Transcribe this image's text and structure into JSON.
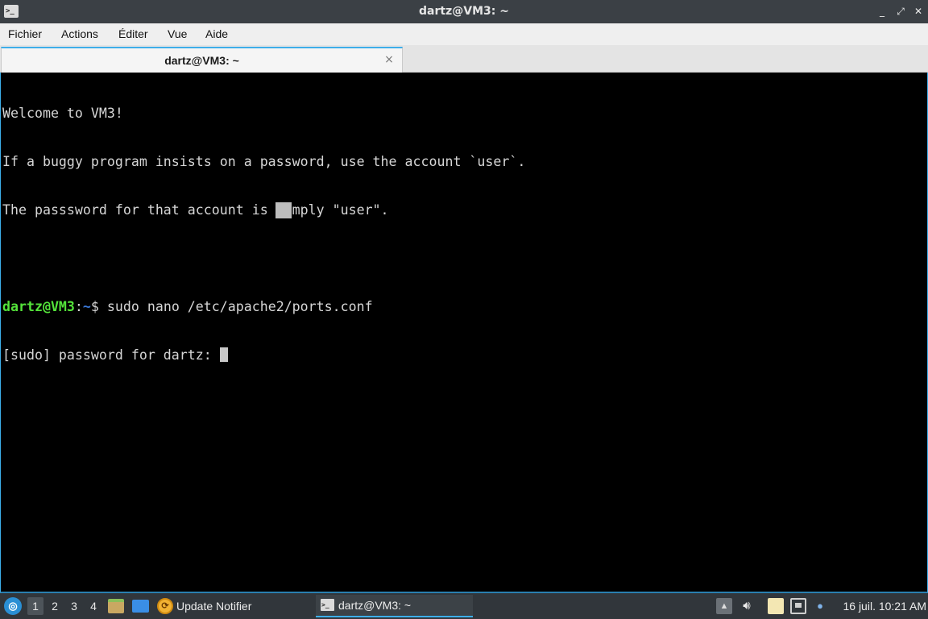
{
  "window": {
    "title": "dartz@VM3: ~",
    "icon": "terminal-icon",
    "minimize_glyph": "_",
    "maximize_glyph": "⤢",
    "close_glyph": "✕"
  },
  "menu": {
    "items": [
      "Fichier",
      "Actions",
      "Éditer",
      "Vue",
      "Aide"
    ]
  },
  "tab": {
    "label": "dartz@VM3: ~",
    "close_glyph": "×"
  },
  "terminal": {
    "motd": [
      "Welcome to VM3!",
      "If a buggy program insists on a password, use the account `user`.",
      "The passsword for that account is simply \"user\"."
    ],
    "prompt_user_host": "dartz@VM3",
    "prompt_sep": ":",
    "prompt_path": "~",
    "prompt_symbol": "$ ",
    "command": "sudo nano /etc/apache2/ports.conf",
    "sudo_prompt": "[sudo] password for dartz: ",
    "colors": {
      "background": "#000000",
      "text": "#d6d6d6",
      "user_host": "#54e33a",
      "path": "#3a78d8"
    }
  },
  "taskbar": {
    "menu_icon": "lubuntu-logo-icon",
    "workspaces": [
      "1",
      "2",
      "3",
      "4"
    ],
    "active_workspace": "1",
    "launchers": [
      "file-manager-icon",
      "show-desktop-icon"
    ],
    "update_notifier": {
      "label": "Update Notifier",
      "icon": "update-notifier-icon"
    },
    "task": {
      "label": "dartz@VM3: ~",
      "icon": "terminal-icon"
    },
    "tray_icons": [
      "tray-arrow-icon",
      "volume-icon",
      "clipboard-icon",
      "network-icon",
      "notification-icon"
    ],
    "clock": "16 juil. 10:21 AM",
    "accent": "#3daee9"
  }
}
